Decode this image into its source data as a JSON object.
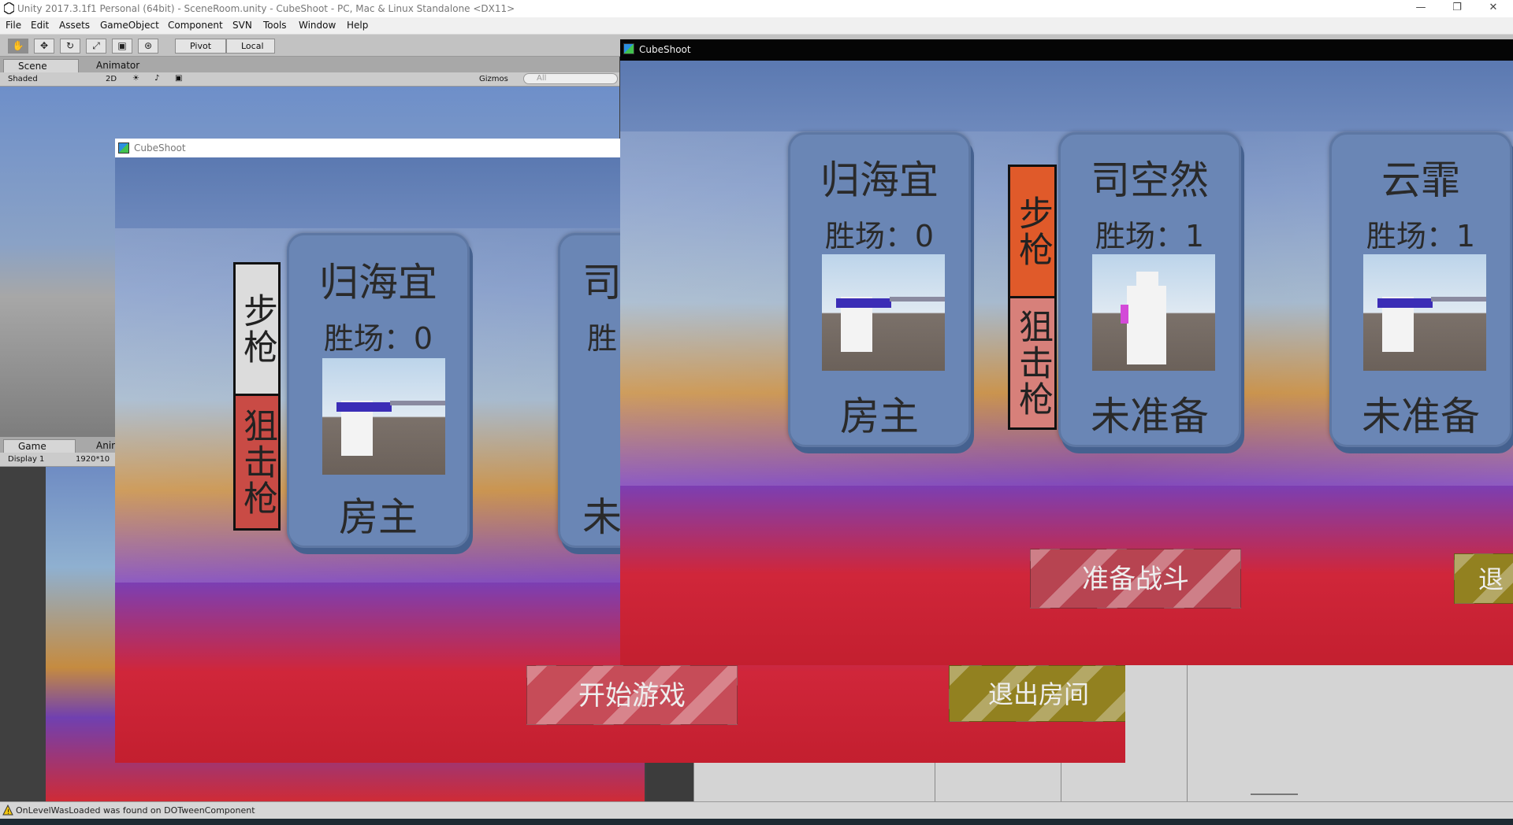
{
  "app": {
    "title": "Unity 2017.3.1f1 Personal (64bit) - SceneRoom.unity - CubeShoot - PC, Mac & Linux Standalone <DX11>",
    "window_controls": [
      "—",
      "❐",
      "✕"
    ]
  },
  "menu": [
    "File",
    "Edit",
    "Assets",
    "GameObject",
    "Component",
    "SVN",
    "Tools",
    "Window",
    "Help"
  ],
  "toolbar": {
    "tools": [
      "hand-icon",
      "move-icon",
      "rotate-icon",
      "scale-icon",
      "rect-icon",
      "transform-icon"
    ],
    "pivot_label": "Pivot",
    "local_label": "Local"
  },
  "scene_panel": {
    "tab_scene": "Scene",
    "tab_animator": "Animator",
    "shading": "Shaded",
    "mode_2d": "2D",
    "gizmos": "Gizmos",
    "search_placeholder": "All"
  },
  "game_panel": {
    "tab_game": "Game",
    "tab_anim": "Anim",
    "display": "Display 1",
    "resolution": "1920*10"
  },
  "back_window": {
    "title": "CubeShoot",
    "weapon_rifle": "步枪",
    "weapon_sniper": "狙击枪",
    "card1": {
      "name": "归海宜",
      "wins": "胜场：0",
      "status": "房主"
    },
    "card2_partial": {
      "name": "司",
      "wins": "胜",
      "status": "未"
    },
    "start_button": "开始游戏",
    "leave_button": "退出房间"
  },
  "front_window": {
    "title": "CubeShoot",
    "weapon_rifle": "步枪",
    "weapon_sniper": "狙击枪",
    "cards": [
      {
        "name": "归海宜",
        "wins": "胜场：0",
        "status": "房主"
      },
      {
        "name": "司空然",
        "wins": "胜场：1",
        "status": "未准备"
      },
      {
        "name": "云霏",
        "wins": "胜场：1",
        "status": "未准备"
      }
    ],
    "ready_button": "准备战斗",
    "leave_partial": "退"
  },
  "status": {
    "message": "OnLevelWasLoaded was found on DOTweenComponent"
  },
  "colors": {
    "card": "#6a86b5",
    "rifle_selected": "#e05a2a",
    "sniper_tab": "#d7807a",
    "floor_red": "#cf2b36",
    "floor_purple": "#7040b0"
  }
}
